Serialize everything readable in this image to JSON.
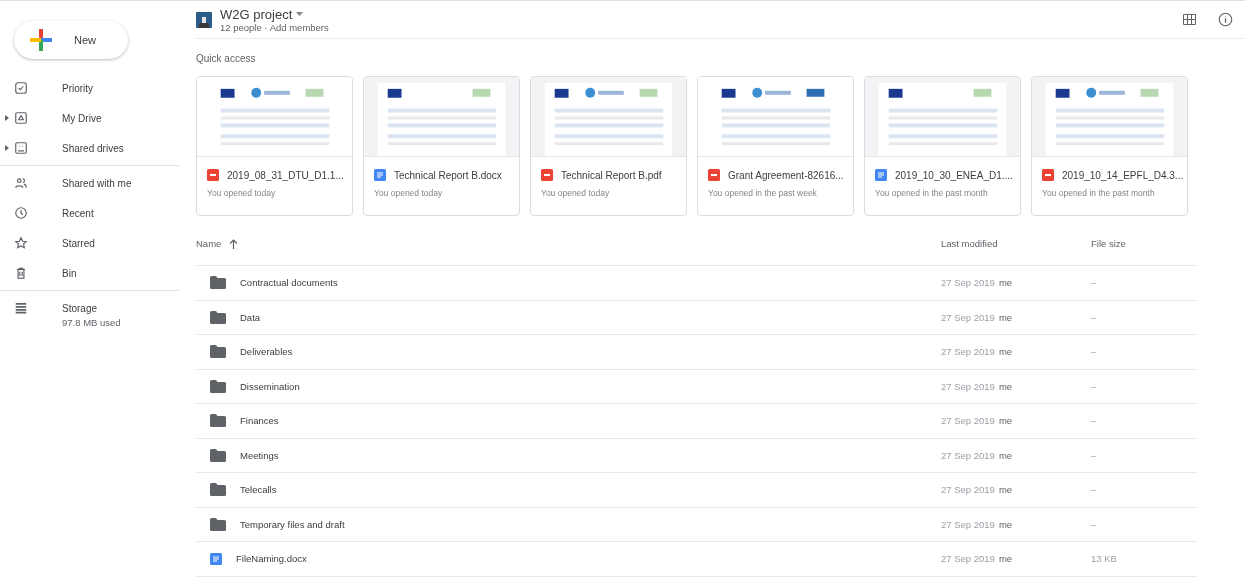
{
  "new_button": {
    "label": "New"
  },
  "sidebar": {
    "groups": [
      {
        "items": [
          {
            "label": "Priority"
          },
          {
            "label": "My Drive",
            "expanded": false
          },
          {
            "label": "Shared drives",
            "expanded": false
          }
        ]
      },
      {
        "items": [
          {
            "label": "Shared with me"
          },
          {
            "label": "Recent"
          },
          {
            "label": "Starred"
          },
          {
            "label": "Bin"
          }
        ]
      },
      {
        "items": [
          {
            "label": "Storage"
          }
        ]
      }
    ]
  },
  "storage": {
    "usage": "97.8 MB used"
  },
  "header": {
    "title": "W2G project",
    "subtitle": "12 people · Add members"
  },
  "quick_access": {
    "heading": "Quick access",
    "cards": [
      {
        "kind": "pdf",
        "name": "2019_08_31_DTU_D1.1...",
        "opened": "You opened today"
      },
      {
        "kind": "docx",
        "name": "Technical Report B.docx",
        "opened": "You opened today"
      },
      {
        "kind": "pdf",
        "name": "Technical Report B.pdf",
        "opened": "You opened today"
      },
      {
        "kind": "pdf",
        "name": "Grant Agreement-82616...",
        "opened": "You opened in the past week"
      },
      {
        "kind": "docx",
        "name": "2019_10_30_ENEA_D1....",
        "opened": "You opened in the past month"
      },
      {
        "kind": "pdf",
        "name": "2019_10_14_EPFL_D4.3...",
        "opened": "You opened in the past month"
      }
    ]
  },
  "table": {
    "columns": [
      {
        "label": "Name",
        "sort_ascending": true
      },
      {
        "label": "Last modified"
      },
      {
        "label": "File size"
      }
    ],
    "rows": [
      {
        "kind": "folder",
        "name": "Contractual documents",
        "modified": "27 Sep 2019",
        "owner": "me",
        "size": "–"
      },
      {
        "kind": "folder",
        "name": "Data",
        "modified": "27 Sep 2019",
        "owner": "me",
        "size": "–"
      },
      {
        "kind": "folder",
        "name": "Deliverables",
        "modified": "27 Sep 2019",
        "owner": "me",
        "size": "–"
      },
      {
        "kind": "folder",
        "name": "Dissemination",
        "modified": "27 Sep 2019",
        "owner": "me",
        "size": "–"
      },
      {
        "kind": "folder",
        "name": "Finances",
        "modified": "27 Sep 2019",
        "owner": "me",
        "size": "–"
      },
      {
        "kind": "folder",
        "name": "Meetings",
        "modified": "27 Sep 2019",
        "owner": "me",
        "size": "–"
      },
      {
        "kind": "folder",
        "name": "Telecalls",
        "modified": "27 Sep 2019",
        "owner": "me",
        "size": "–"
      },
      {
        "kind": "folder",
        "name": "Temporary files and draft",
        "modified": "27 Sep 2019",
        "owner": "me",
        "size": "–"
      },
      {
        "kind": "docx",
        "name": "FileNaming.docx",
        "modified": "27 Sep 2019",
        "owner": "me",
        "size": "13 KB"
      }
    ]
  }
}
